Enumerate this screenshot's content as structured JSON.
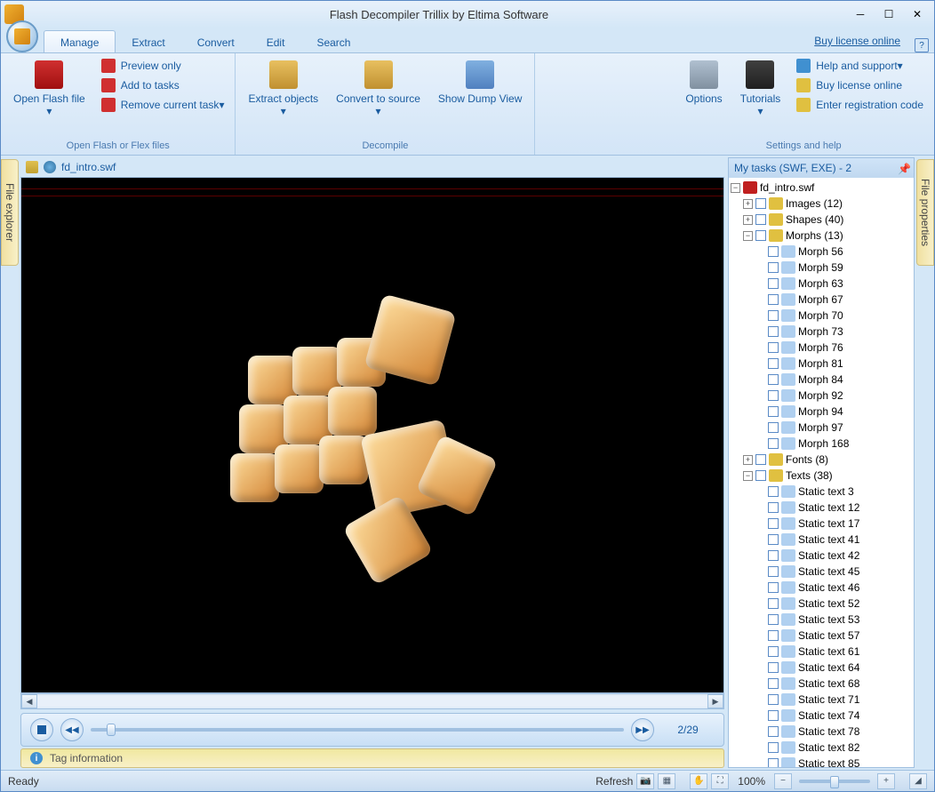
{
  "title": "Flash Decompiler Trillix by Eltima Software",
  "link_buy": "Buy license online",
  "tabs": [
    "Manage",
    "Extract",
    "Convert",
    "Edit",
    "Search"
  ],
  "ribbon": {
    "open_flash": "Open Flash file",
    "preview_only": "Preview only",
    "add_to_tasks": "Add to tasks",
    "remove_current": "Remove current task",
    "group1": "Open Flash or Flex files",
    "extract": "Extract objects",
    "convert": "Convert to source",
    "show_dump": "Show Dump View",
    "group2": "Decompile",
    "options": "Options",
    "tutorials": "Tutorials",
    "help": "Help and support",
    "buy": "Buy license online",
    "register": "Enter registration code",
    "group3": "Settings and help"
  },
  "side_left": "File explorer",
  "side_right": "File properties",
  "file_tab": "fd_intro.swf",
  "player": {
    "frames": "2/29"
  },
  "tag_info": "Tag information",
  "tasks": {
    "header": "My tasks (SWF, EXE) - 2",
    "root": "fd_intro.swf",
    "groups": [
      {
        "label": "Images (12)",
        "expanded": false,
        "icon": "#e0c040"
      },
      {
        "label": "Shapes (40)",
        "expanded": false,
        "icon": "#e0c040"
      },
      {
        "label": "Morphs (13)",
        "expanded": true,
        "icon": "#e0c040",
        "items": [
          "Morph 56",
          "Morph 59",
          "Morph 63",
          "Morph 67",
          "Morph 70",
          "Morph 73",
          "Morph 76",
          "Morph 81",
          "Morph 84",
          "Morph 92",
          "Morph 94",
          "Morph 97",
          "Morph 168"
        ]
      },
      {
        "label": "Fonts (8)",
        "expanded": false,
        "icon": "#e0c040"
      },
      {
        "label": "Texts (38)",
        "expanded": true,
        "icon": "#e0c040",
        "items": [
          "Static text 3",
          "Static text 12",
          "Static text 17",
          "Static text 41",
          "Static text 42",
          "Static text 45",
          "Static text 46",
          "Static text 52",
          "Static text 53",
          "Static text 57",
          "Static text 61",
          "Static text 64",
          "Static text 68",
          "Static text 71",
          "Static text 74",
          "Static text 78",
          "Static text 82",
          "Static text 85"
        ]
      }
    ]
  },
  "status": {
    "ready": "Ready",
    "refresh": "Refresh",
    "zoom": "100%"
  }
}
